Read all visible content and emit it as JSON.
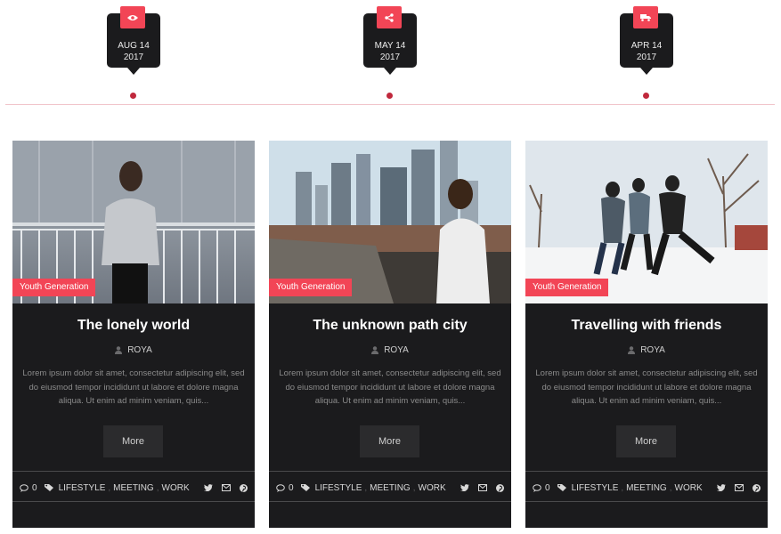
{
  "timeline": [
    {
      "date_line1": "AUG 14",
      "date_line2": "2017",
      "icon": "eye-icon"
    },
    {
      "date_line1": "MAY 14",
      "date_line2": "2017",
      "icon": "share-icon"
    },
    {
      "date_line1": "APR 14",
      "date_line2": "2017",
      "icon": "truck-icon"
    }
  ],
  "posts": [
    {
      "category": "Youth Generation",
      "title": "The lonely world",
      "author": "ROYA",
      "excerpt": "Lorem ipsum dolor sit amet, consectetur adipiscing elit, sed do eiusmod tempor incididunt ut labore et dolore magna aliqua. Ut enim ad minim veniam, quis...",
      "more_label": "More",
      "comments": "0",
      "tags": [
        "LIFESTYLE",
        "MEETING",
        "WORK"
      ]
    },
    {
      "category": "Youth Generation",
      "title": "The unknown path city",
      "author": "ROYA",
      "excerpt": "Lorem ipsum dolor sit amet, consectetur adipiscing elit, sed do eiusmod tempor incididunt ut labore et dolore magna aliqua. Ut enim ad minim veniam, quis...",
      "more_label": "More",
      "comments": "0",
      "tags": [
        "LIFESTYLE",
        "MEETING",
        "WORK"
      ]
    },
    {
      "category": "Youth Generation",
      "title": "Travelling with friends",
      "author": "ROYA",
      "excerpt": "Lorem ipsum dolor sit amet, consectetur adipiscing elit, sed do eiusmod tempor incididunt ut labore et dolore magna aliqua. Ut enim ad minim veniam, quis...",
      "more_label": "More",
      "comments": "0",
      "tags": [
        "LIFESTYLE",
        "MEETING",
        "WORK"
      ]
    }
  ],
  "colors": {
    "accent": "#f24556",
    "card_bg": "#1b1b1d",
    "timeline_line": "#f1c4ca"
  }
}
